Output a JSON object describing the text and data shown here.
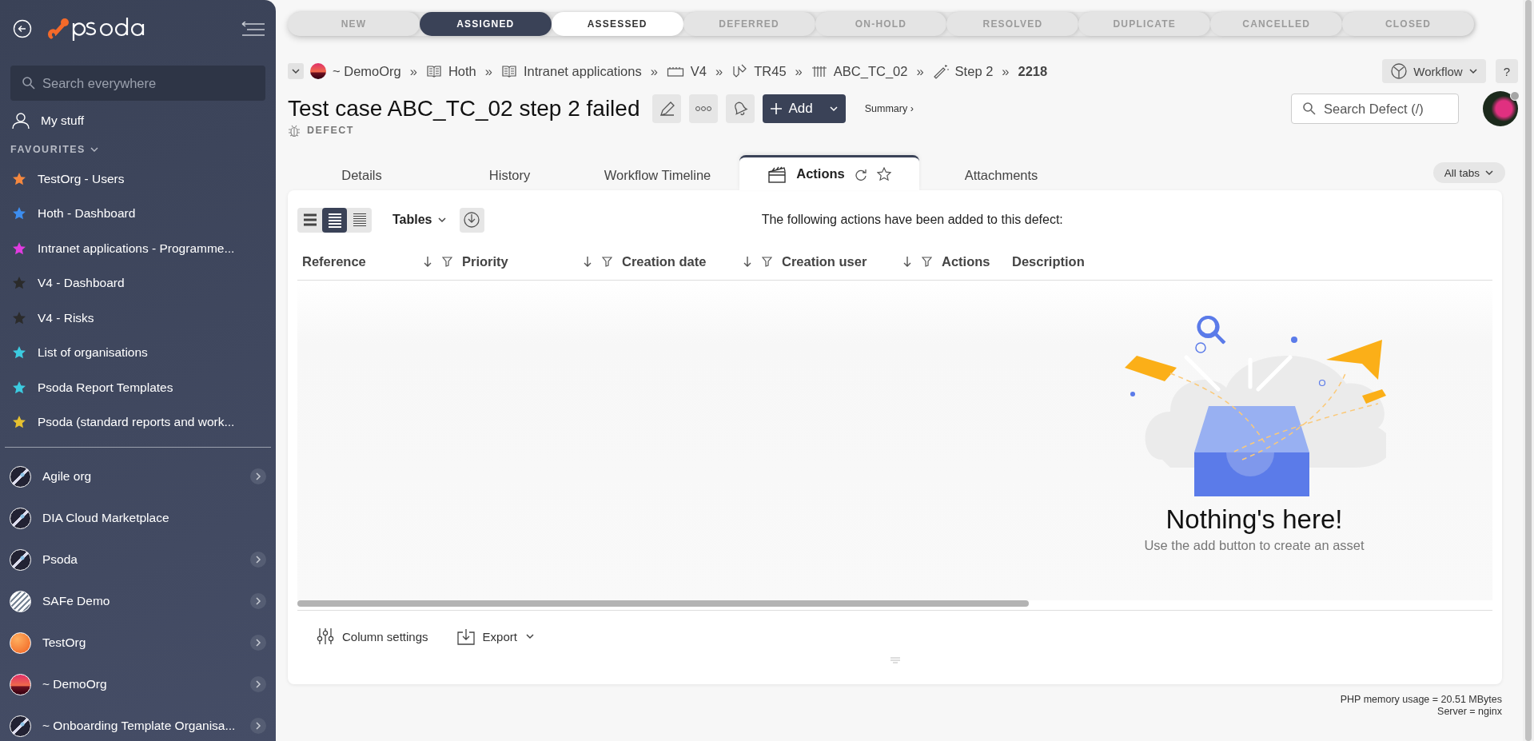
{
  "sidebar": {
    "search": {
      "placeholder": "Search everywhere"
    },
    "my_stuff": "My stuff",
    "favourites_heading": "FAVOURITES",
    "favourites_expanded": true,
    "favourites": [
      {
        "label": "TestOrg - Users",
        "color": "#f5883f"
      },
      {
        "label": "Hoth - Dashboard",
        "color": "#3d8ef0"
      },
      {
        "label": "Intranet applications - Programme...",
        "color": "#e03ce0"
      },
      {
        "label": "V4 - Dashboard",
        "color": "#2b2b2b"
      },
      {
        "label": "V4 - Risks",
        "color": "#2b2b2b"
      },
      {
        "label": "List of organisations",
        "color": "#3ccbe0"
      },
      {
        "label": "Psoda Report Templates",
        "color": "#3ccbe0"
      },
      {
        "label": "Psoda (standard reports and work...",
        "color": "#e6c130"
      }
    ],
    "organisations": [
      {
        "label": "Agile org",
        "has_children": true
      },
      {
        "label": "DIA Cloud Marketplace",
        "has_children": false
      },
      {
        "label": "Psoda",
        "has_children": true
      },
      {
        "label": "SAFe Demo",
        "has_children": true
      },
      {
        "label": "TestOrg",
        "has_children": true
      },
      {
        "label": "~ DemoOrg",
        "has_children": true
      },
      {
        "label": "~ Onboarding Template Organisa...",
        "has_children": true
      }
    ]
  },
  "workflow_steps": [
    {
      "label": "NEW",
      "selected": false,
      "enabled": false
    },
    {
      "label": "ASSIGNED",
      "selected": true,
      "enabled": false
    },
    {
      "label": "ASSESSED",
      "selected": false,
      "enabled": true
    },
    {
      "label": "DEFERRED",
      "selected": false,
      "enabled": false
    },
    {
      "label": "ON-HOLD",
      "selected": false,
      "enabled": false
    },
    {
      "label": "RESOLVED",
      "selected": false,
      "enabled": false
    },
    {
      "label": "DUPLICATE",
      "selected": false,
      "enabled": false
    },
    {
      "label": "CANCELLED",
      "selected": false,
      "enabled": false
    },
    {
      "label": "CLOSED",
      "selected": false,
      "enabled": false
    }
  ],
  "breadcrumb": [
    {
      "label": "~ DemoOrg",
      "separator": "»",
      "current": false
    },
    {
      "label": "Hoth",
      "separator": "»",
      "current": false
    },
    {
      "label": "Intranet applications",
      "separator": "»",
      "current": false
    },
    {
      "label": "V4",
      "separator": "»",
      "current": false
    },
    {
      "label": "TR45",
      "separator": "»",
      "current": false
    },
    {
      "label": "ABC_TC_02",
      "separator": "»",
      "current": false
    },
    {
      "label": "Step 2",
      "separator": "»",
      "current": false
    },
    {
      "label": "2218",
      "current": true
    }
  ],
  "workflow_button": "Workflow",
  "help_button": "?",
  "title": "Test case ABC_TC_02 step 2 failed",
  "add_button": "Add",
  "summary_link": "Summary ›",
  "type_label": "DEFECT",
  "search": {
    "placeholder": "Search Defect (/)"
  },
  "tabs": [
    {
      "label": "Details",
      "selected": false
    },
    {
      "label": "History",
      "selected": false
    },
    {
      "label": "Workflow Timeline",
      "selected": false
    },
    {
      "label": "Actions",
      "selected": true
    },
    {
      "label": "Attachments",
      "selected": false
    }
  ],
  "all_tabs_button": "All tabs",
  "toolbar": {
    "views": [
      {
        "kind": "wide",
        "selected": false
      },
      {
        "kind": "compact",
        "selected": true
      },
      {
        "kind": "dense",
        "selected": false
      }
    ],
    "tables_menu": "Tables",
    "info": "The following actions have been added to this defect:"
  },
  "table": {
    "columns": [
      {
        "label": "Reference",
        "sortable": true
      },
      {
        "label": "Priority",
        "sortable": true
      },
      {
        "label": "Creation date",
        "sortable": true
      },
      {
        "label": "Creation user",
        "sortable": true
      },
      {
        "label": "Actions",
        "sortable": false
      },
      {
        "label": "Description",
        "sortable": false
      }
    ]
  },
  "empty_state": {
    "title": "Nothing's here!",
    "message": "Use the add button to create an asset"
  },
  "footer": {
    "column_settings": "Column settings",
    "export": "Export"
  },
  "status": {
    "memory": "PHP memory usage = 20.51 MBytes",
    "server": "Server = nginx"
  }
}
